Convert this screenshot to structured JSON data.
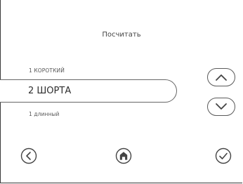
{
  "screen": {
    "title": "Посчитать"
  },
  "picker": {
    "previous_option": "1 КОРОТКИЙ",
    "selected_option": "2 ШОРТА",
    "next_option": "1 длинный"
  },
  "icons": {
    "up": "chevron-up-icon",
    "down": "chevron-down-icon",
    "back": "back-arrow-icon",
    "home": "home-icon",
    "confirm": "checkmark-icon"
  }
}
